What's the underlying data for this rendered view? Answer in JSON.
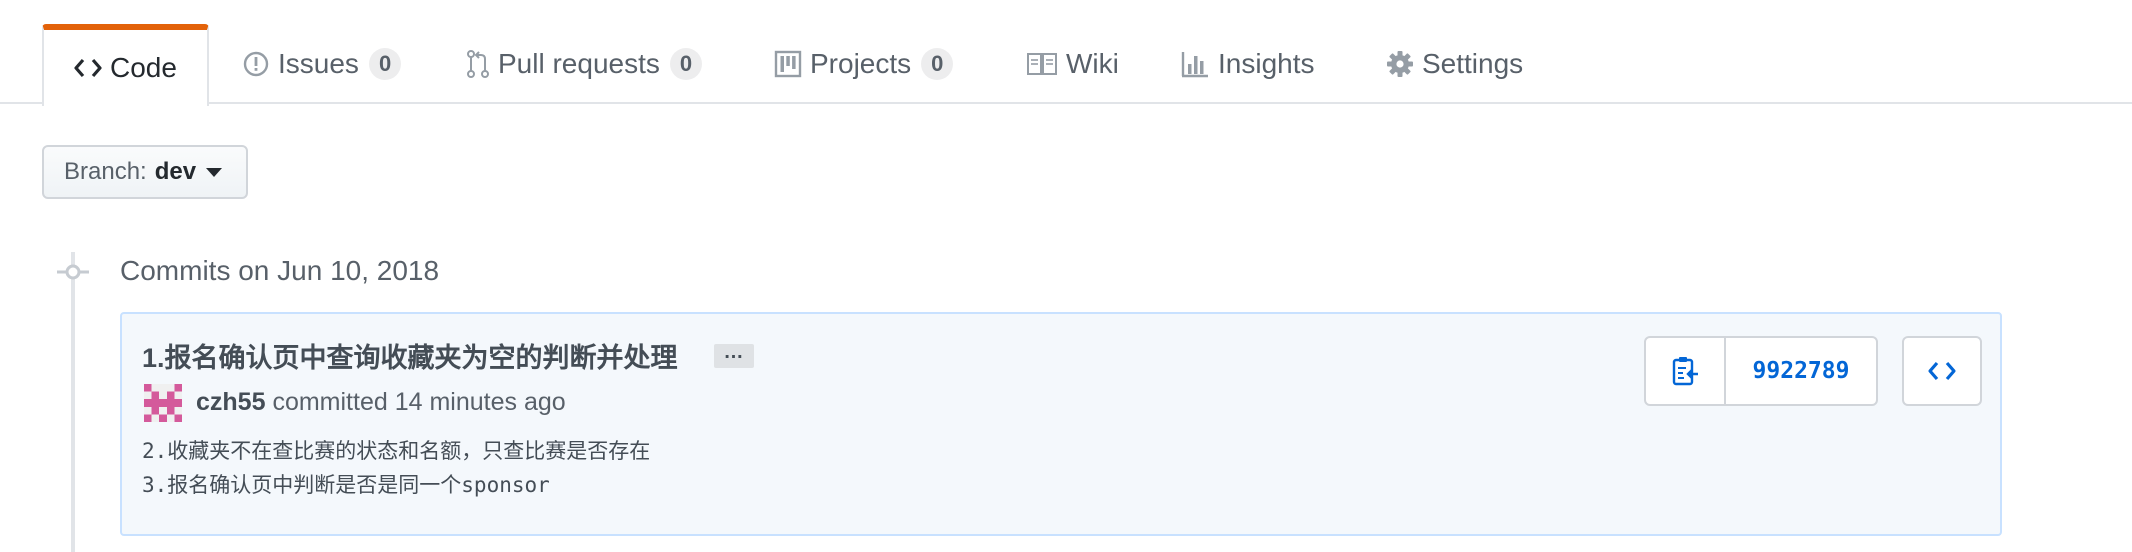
{
  "tabs": [
    {
      "label": "Code",
      "icon": "code-icon",
      "selected": true
    },
    {
      "label": "Issues",
      "icon": "issue-opened-icon",
      "count": "0"
    },
    {
      "label": "Pull requests",
      "icon": "git-pull-request-icon",
      "count": "0"
    },
    {
      "label": "Projects",
      "icon": "project-icon",
      "count": "0"
    },
    {
      "label": "Wiki",
      "icon": "book-icon"
    },
    {
      "label": "Insights",
      "icon": "graph-icon"
    },
    {
      "label": "Settings",
      "icon": "gear-icon"
    }
  ],
  "branch": {
    "label": "Branch:",
    "value": "dev"
  },
  "commit_group": {
    "title": "Commits on Jun 10, 2018"
  },
  "commit": {
    "title": "1.报名确认页中查询收藏夹为空的判断并处理",
    "expand_label": "…",
    "author": "czh55",
    "action": "committed",
    "time": "14 minutes ago",
    "description_lines": [
      "2.收藏夹不在查比赛的状态和名额，只查比赛是否存在",
      "3.报名确认页中判断是否是同一个sponsor"
    ],
    "sha": "9922789"
  },
  "colors": {
    "accent_tab": "#e36209",
    "link": "#0366d6",
    "commit_bg": "#f4f8fc",
    "commit_border": "#c8e1ff",
    "avatar": "#d45a9b"
  }
}
